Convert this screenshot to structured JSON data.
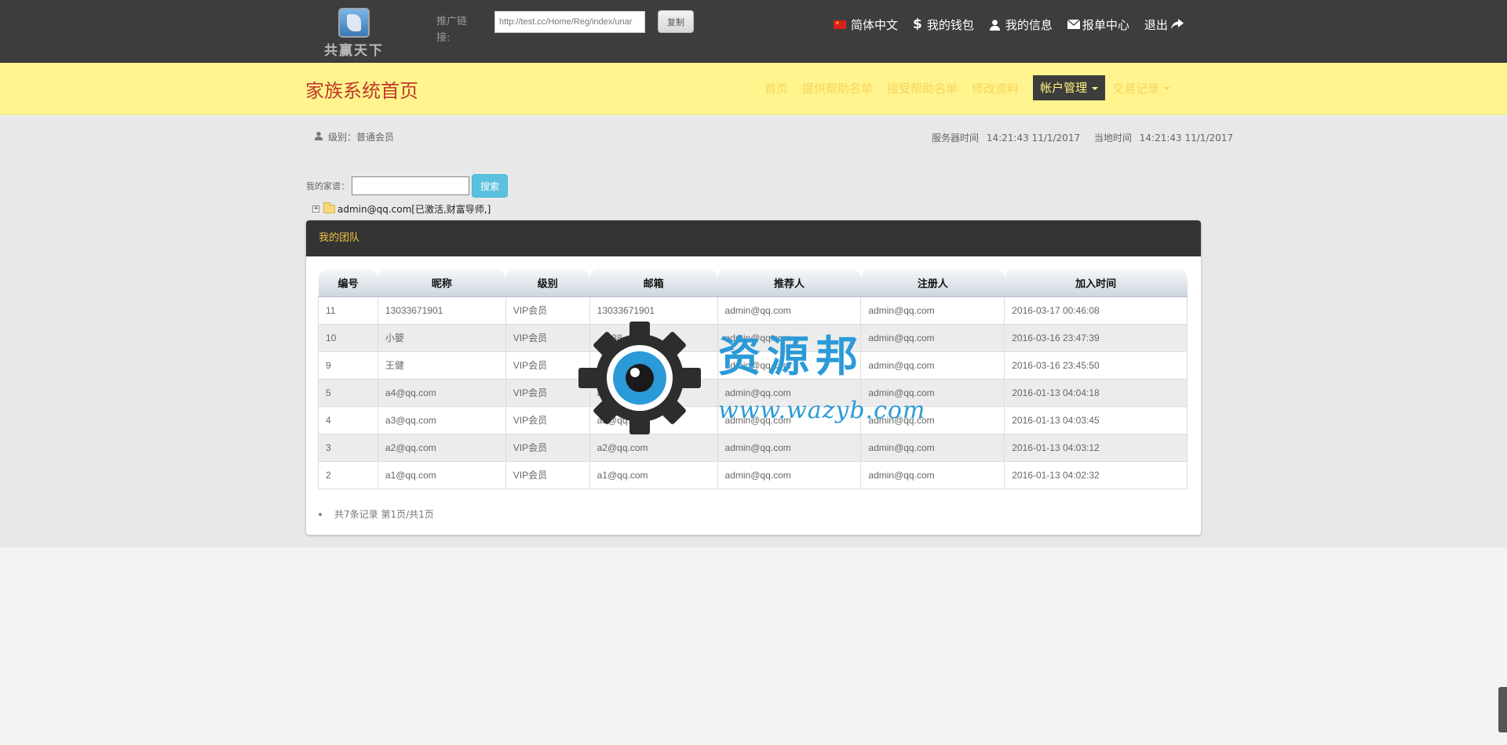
{
  "topbar": {
    "logo_text": "共赢天下",
    "promo_label": "推广链接:",
    "promo_link": "http://test.cc/Home/Reg/index/unar",
    "copy_button": "复制",
    "nav": [
      {
        "label": "简体中文",
        "icon": "china-flag-icon"
      },
      {
        "label": "我的钱包",
        "icon": "dollar-icon"
      },
      {
        "label": "我的信息",
        "icon": "user-icon"
      },
      {
        "label": "报单中心",
        "icon": "envelope-icon"
      },
      {
        "label": "退出",
        "icon": "share-arrow-icon"
      }
    ]
  },
  "header": {
    "title": "家族系统首页",
    "nav": [
      {
        "label": "首页"
      },
      {
        "label": "提供帮助名单"
      },
      {
        "label": "接受帮助名单"
      },
      {
        "label": "修改资料"
      },
      {
        "label": "帐户管理",
        "active": true
      },
      {
        "label": "交易记录"
      }
    ]
  },
  "info": {
    "level_text": "级别：普通会员",
    "server_time_label": "服务器时间",
    "server_time": "14:21:43 11/1/2017",
    "local_time_label": "当地时间",
    "local_time": "14:21:43 11/1/2017"
  },
  "search": {
    "label": "我的家谱：",
    "value": "",
    "button": "搜索"
  },
  "tree": {
    "root_label": "admin@qq.com[已激活,财富导师,]"
  },
  "team": {
    "title": "我的团队",
    "columns": [
      "编号",
      "昵称",
      "级别",
      "邮箱",
      "推荐人",
      "注册人",
      "加入时间"
    ],
    "rows": [
      [
        "11",
        "13033671901",
        "VIP会员",
        "13033671901",
        "admin@qq.com",
        "admin@qq.com",
        "2016-03-17 00:46:08"
      ],
      [
        "10",
        "小嬰",
        "VIP会员",
        "…288",
        "admin@qq.com",
        "admin@qq.com",
        "2016-03-16 23:47:39"
      ],
      [
        "9",
        "王健",
        "VIP会员",
        "…1647",
        "admin@qq.com",
        "admin@qq.com",
        "2016-03-16 23:45:50"
      ],
      [
        "5",
        "a4@qq.com",
        "VIP会员",
        "a4@qq.com",
        "admin@qq.com",
        "admin@qq.com",
        "2016-01-13 04:04:18"
      ],
      [
        "4",
        "a3@qq.com",
        "VIP会员",
        "a3@qq.com",
        "admin@qq.com",
        "admin@qq.com",
        "2016-01-13 04:03:45"
      ],
      [
        "3",
        "a2@qq.com",
        "VIP会员",
        "a2@qq.com",
        "admin@qq.com",
        "admin@qq.com",
        "2016-01-13 04:03:12"
      ],
      [
        "2",
        "a1@qq.com",
        "VIP会员",
        "a1@qq.com",
        "admin@qq.com",
        "admin@qq.com",
        "2016-01-13 04:02:32"
      ]
    ],
    "pager_text": "共7条记录 第1页/共1页"
  },
  "watermark": {
    "text": "资源邦",
    "url": "www.wazyb.com"
  },
  "colors": {
    "topbar_bg": "#3d3d3d",
    "header_bg": "#fff48d",
    "title_red": "#c0392b",
    "nav_gold": "#f6d45e",
    "panel_head_bg": "#333333",
    "search_btn": "#5bc0de"
  }
}
